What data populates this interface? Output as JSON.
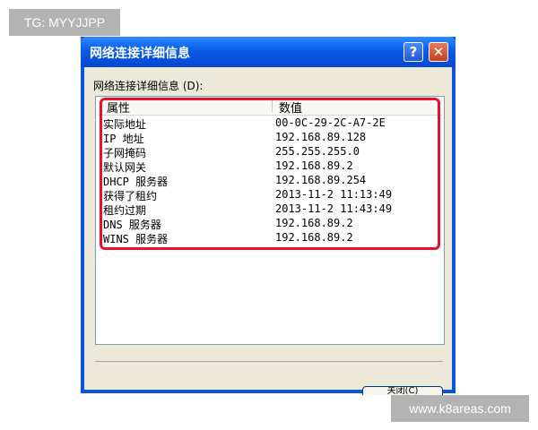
{
  "watermarks": {
    "top_left": "TG: MYYJJPP",
    "bottom_right": "www.k8areas.com"
  },
  "dialog": {
    "title": "网络连接详细信息",
    "help_glyph": "?",
    "close_glyph": "✕",
    "group_label": "网络连接详细信息 (D):",
    "columns": {
      "property": "属性",
      "value": "数值"
    },
    "rows": [
      {
        "key": "实际地址",
        "value": "00-0C-29-2C-A7-2E"
      },
      {
        "key": "IP 地址",
        "value": "192.168.89.128"
      },
      {
        "key": "子网掩码",
        "value": "255.255.255.0"
      },
      {
        "key": "默认网关",
        "value": "192.168.89.2"
      },
      {
        "key": "DHCP 服务器",
        "value": "192.168.89.254"
      },
      {
        "key": "获得了租约",
        "value": "2013-11-2 11:13:49"
      },
      {
        "key": "租约过期",
        "value": "2013-11-2 11:43:49"
      },
      {
        "key": "DNS 服务器",
        "value": "192.168.89.2"
      },
      {
        "key": "WINS 服务器",
        "value": "192.168.89.2"
      }
    ],
    "close_button": "关闭(C)"
  },
  "colors": {
    "titlebar": "#0a5be8",
    "highlight": "#e8102a",
    "dialog_bg": "#ece9d8"
  }
}
